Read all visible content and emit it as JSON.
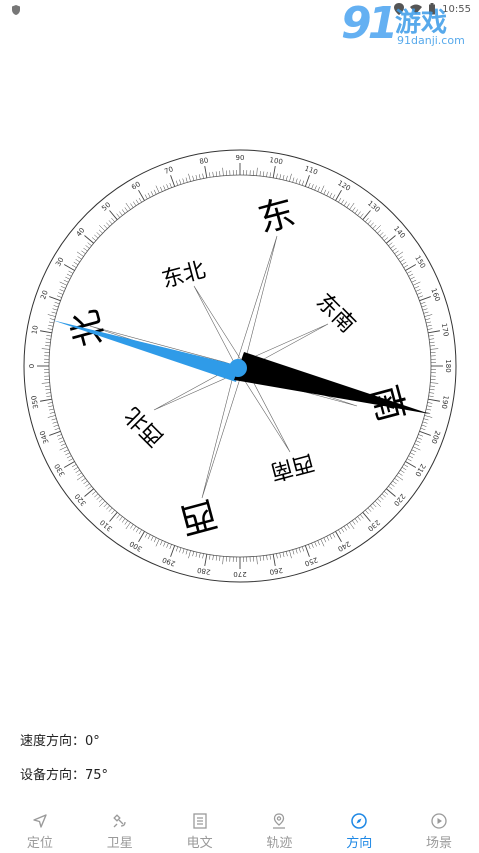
{
  "status_bar": {
    "time": "10:55"
  },
  "watermark": {
    "number": "91",
    "text": "游戏",
    "url": "91danji.com"
  },
  "compass": {
    "directions": {
      "east": "东",
      "west": "西",
      "south": "南",
      "north": "北",
      "northeast": "东北",
      "southeast": "东南",
      "southwest": "西南",
      "northwest": "西北"
    },
    "tick_labels": [
      "0",
      "10",
      "20",
      "30",
      "40",
      "50",
      "60",
      "70",
      "80",
      "90",
      "100",
      "110",
      "120",
      "130",
      "140",
      "150",
      "160",
      "170",
      "180",
      "190",
      "200",
      "210",
      "220",
      "230",
      "240",
      "250",
      "260",
      "270",
      "280",
      "290",
      "300",
      "310",
      "320",
      "330",
      "340",
      "350"
    ],
    "device_heading": 75,
    "colors": {
      "needle_north": "#2f9be8",
      "needle_south": "#000000",
      "ring": "#333333"
    }
  },
  "info": {
    "speed_direction": "速度方向：0°",
    "device_direction": "设备方向：75°"
  },
  "tabs": [
    {
      "label": "定位",
      "icon": "location-arrow-icon",
      "active": false
    },
    {
      "label": "卫星",
      "icon": "satellite-icon",
      "active": false
    },
    {
      "label": "电文",
      "icon": "document-icon",
      "active": false
    },
    {
      "label": "轨迹",
      "icon": "map-pin-icon",
      "active": false
    },
    {
      "label": "方向",
      "icon": "compass-icon",
      "active": true
    },
    {
      "label": "场景",
      "icon": "play-icon",
      "active": false
    }
  ],
  "colors": {
    "accent": "#1e88e5",
    "inactive": "#9a9a9a"
  }
}
